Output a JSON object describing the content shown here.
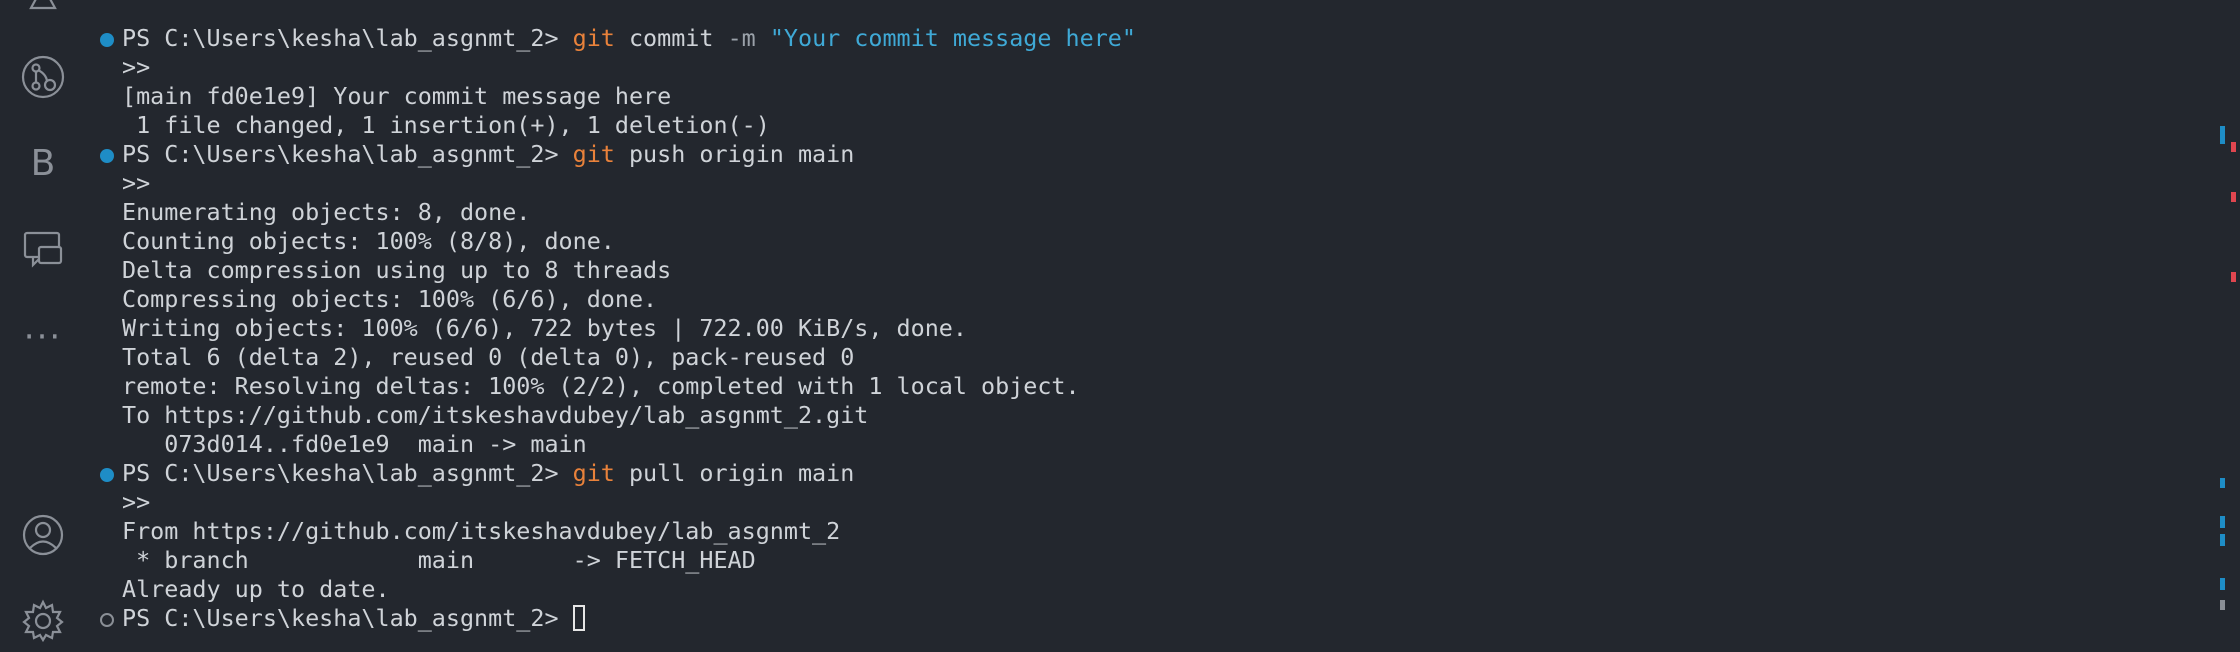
{
  "activity_bar": {
    "items": [
      {
        "name": "source-control-icon"
      },
      {
        "name": "bookmarks-icon",
        "letter": "B"
      },
      {
        "name": "chat-icon"
      },
      {
        "name": "more-icon",
        "text": "···"
      },
      {
        "name": "account-icon"
      },
      {
        "name": "settings-icon"
      }
    ]
  },
  "terminal": {
    "prompt": "PS C:\\Users\\kesha\\lab_asgnmt_2> ",
    "commands": [
      {
        "git": "git",
        "rest": " commit ",
        "flag": "-m",
        "arg": " \"Your commit message here\""
      },
      {
        "git": "git",
        "rest": " push origin main"
      },
      {
        "git": "git",
        "rest": " pull origin main"
      }
    ],
    "continuation": ">>",
    "commit_output": [
      "[main fd0e1e9] Your commit message here",
      " 1 file changed, 1 insertion(+), 1 deletion(-)"
    ],
    "push_output": [
      "Enumerating objects: 8, done.",
      "Counting objects: 100% (8/8), done.",
      "Delta compression using up to 8 threads",
      "Compressing objects: 100% (6/6), done.",
      "Writing objects: 100% (6/6), 722 bytes | 722.00 KiB/s, done.",
      "Total 6 (delta 2), reused 0 (delta 0), pack-reused 0",
      "remote: Resolving deltas: 100% (2/2), completed with 1 local object.",
      "To https://github.com/itskeshavdubey/lab_asgnmt_2.git",
      "   073d014..fd0e1e9  main -> main"
    ],
    "pull_output": [
      "From https://github.com/itskeshavdubey/lab_asgnmt_2",
      " * branch            main       -> FETCH_HEAD",
      "Already up to date."
    ]
  },
  "colors": {
    "background": "#23272e",
    "text": "#cfd3d8",
    "git_keyword": "#e9823b",
    "string": "#3fa9d6",
    "success_decoration": "#1e8dc6",
    "ruler_error": "#e0464f"
  }
}
